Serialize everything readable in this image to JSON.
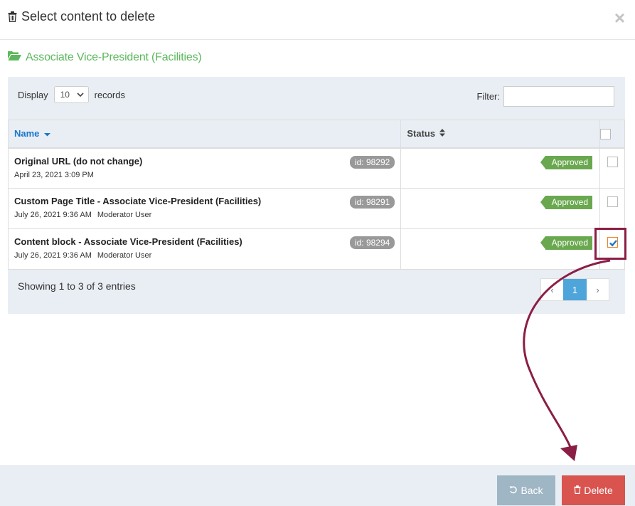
{
  "modal": {
    "title": "Select content to delete",
    "close": "×"
  },
  "folder": {
    "name": "Associate Vice-President (Facilities)"
  },
  "length": {
    "label_before": "Display",
    "value": "10",
    "label_after": "records"
  },
  "filter": {
    "label": "Filter:",
    "value": ""
  },
  "table": {
    "columns": {
      "name": "Name",
      "status": "Status"
    },
    "rows": [
      {
        "title": "Original URL (do not change)",
        "date": "April 23, 2021 3:09 PM",
        "user": "",
        "id": "id: 98292",
        "status": "Approved",
        "checked": false
      },
      {
        "title": "Custom Page Title - Associate Vice-President (Facilities)",
        "date": "July 26, 2021 9:36 AM",
        "user": "Moderator User",
        "id": "id: 98291",
        "status": "Approved",
        "checked": false
      },
      {
        "title": "Content block - Associate Vice-President (Facilities)",
        "date": "July 26, 2021 9:36 AM",
        "user": "Moderator User",
        "id": "id: 98294",
        "status": "Approved",
        "checked": true
      }
    ]
  },
  "info": "Showing 1 to 3 of 3 entries",
  "pager": {
    "prev": "‹",
    "current": "1",
    "next": "›"
  },
  "footer": {
    "back_label": "Back",
    "delete_label": "Delete"
  },
  "colors": {
    "accent_green": "#5cb85c",
    "delete_red": "#d9534f",
    "highlight": "#8b1e45"
  }
}
